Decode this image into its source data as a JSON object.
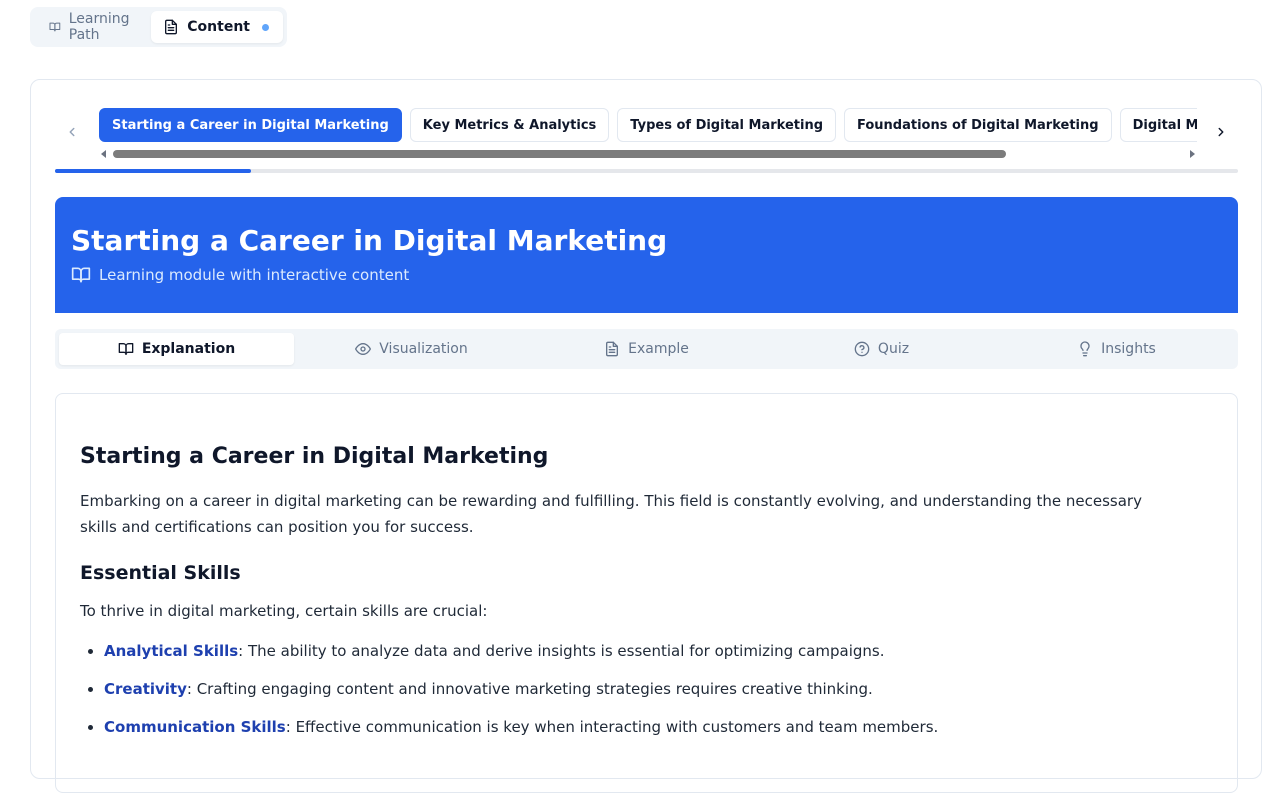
{
  "view_switch": {
    "tabs": [
      {
        "label": "Learning Path",
        "icon": "book-open-icon",
        "active": false
      },
      {
        "label": "Content",
        "icon": "file-text-icon",
        "active": true
      }
    ]
  },
  "topics": [
    {
      "label": "Starting a Career in Digital Marketing",
      "active": true
    },
    {
      "label": "Key Metrics & Analytics",
      "active": false
    },
    {
      "label": "Types of Digital Marketing",
      "active": false
    },
    {
      "label": "Foundations of Digital Marketing",
      "active": false
    },
    {
      "label": "Digital Marketing Overview",
      "active": false
    }
  ],
  "progress": {
    "fraction": 0.166
  },
  "banner": {
    "title": "Starting a Career in Digital Marketing",
    "subtitle": "Learning module with interactive content"
  },
  "section_tabs": [
    {
      "label": "Explanation",
      "icon": "book-open-icon",
      "active": true
    },
    {
      "label": "Visualization",
      "icon": "eye-icon",
      "active": false
    },
    {
      "label": "Example",
      "icon": "file-text-icon",
      "active": false
    },
    {
      "label": "Quiz",
      "icon": "help-circle-icon",
      "active": false
    },
    {
      "label": "Insights",
      "icon": "lightbulb-icon",
      "active": false
    }
  ],
  "content": {
    "heading": "Starting a Career in Digital Marketing",
    "intro": "Embarking on a career in digital marketing can be rewarding and fulfilling. This field is constantly evolving, and understanding the necessary skills and certifications can position you for success.",
    "skills_heading": "Essential Skills",
    "skills_intro": "To thrive in digital marketing, certain skills are crucial:",
    "skills": [
      {
        "term": "Analytical Skills",
        "text": ": The ability to analyze data and derive insights is essential for optimizing campaigns."
      },
      {
        "term": "Creativity",
        "text": ": Crafting engaging content and innovative marketing strategies requires creative thinking."
      },
      {
        "term": "Communication Skills",
        "text": ": Effective communication is key when interacting with customers and team members."
      }
    ]
  },
  "colors": {
    "accent": "#2563eb",
    "term": "#1e40af",
    "muted": "#64748b"
  }
}
